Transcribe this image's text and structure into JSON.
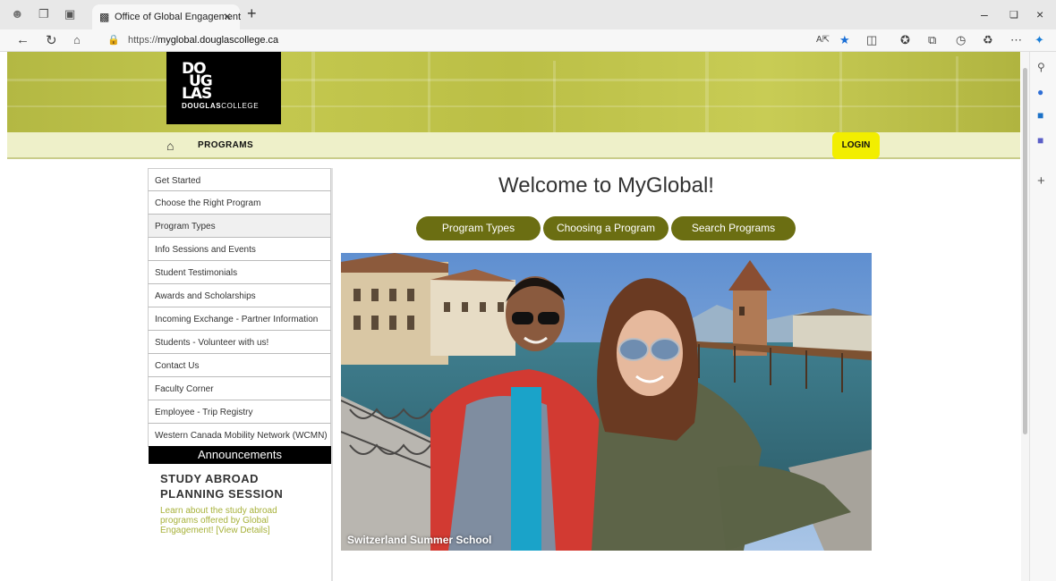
{
  "browser": {
    "tab_title": "Office of Global Engagement",
    "url_prefix": "https://",
    "url_host": "myglobal.douglascollege.ca"
  },
  "logo": {
    "line1": "DO",
    "line2": "UG",
    "line3": "LAS",
    "word_bold": "DOUGLAS",
    "word_light": "COLLEGE"
  },
  "nav": {
    "programs": "PROGRAMS",
    "login": "LOGIN"
  },
  "menu": [
    "Get Started",
    "Choose the Right Program",
    "Program Types",
    "Info Sessions and Events",
    "Student Testimonials",
    "Awards and Scholarships",
    "Incoming Exchange - Partner Information",
    "Students - Volunteer with us!",
    "Contact Us",
    "Faculty Corner",
    "Employee - Trip Registry",
    "Western Canada Mobility Network (WCMN)"
  ],
  "announcements": {
    "heading": "Announcements",
    "title": "STUDY ABROAD PLANNING SESSION",
    "body": "Learn about the study abroad programs offered by Global Engagement! [View Details]"
  },
  "main": {
    "welcome": "Welcome to MyGlobal!",
    "buttons": [
      "Program Types",
      "Choosing a Program",
      "Search Programs"
    ],
    "caption": "Switzerland Summer School"
  },
  "colors": {
    "accent_olive": "#6b6e12",
    "header_yellow_green": "#c4c84f",
    "login_yellow": "#f2ee00",
    "announcement_text": "#a7b13a"
  }
}
